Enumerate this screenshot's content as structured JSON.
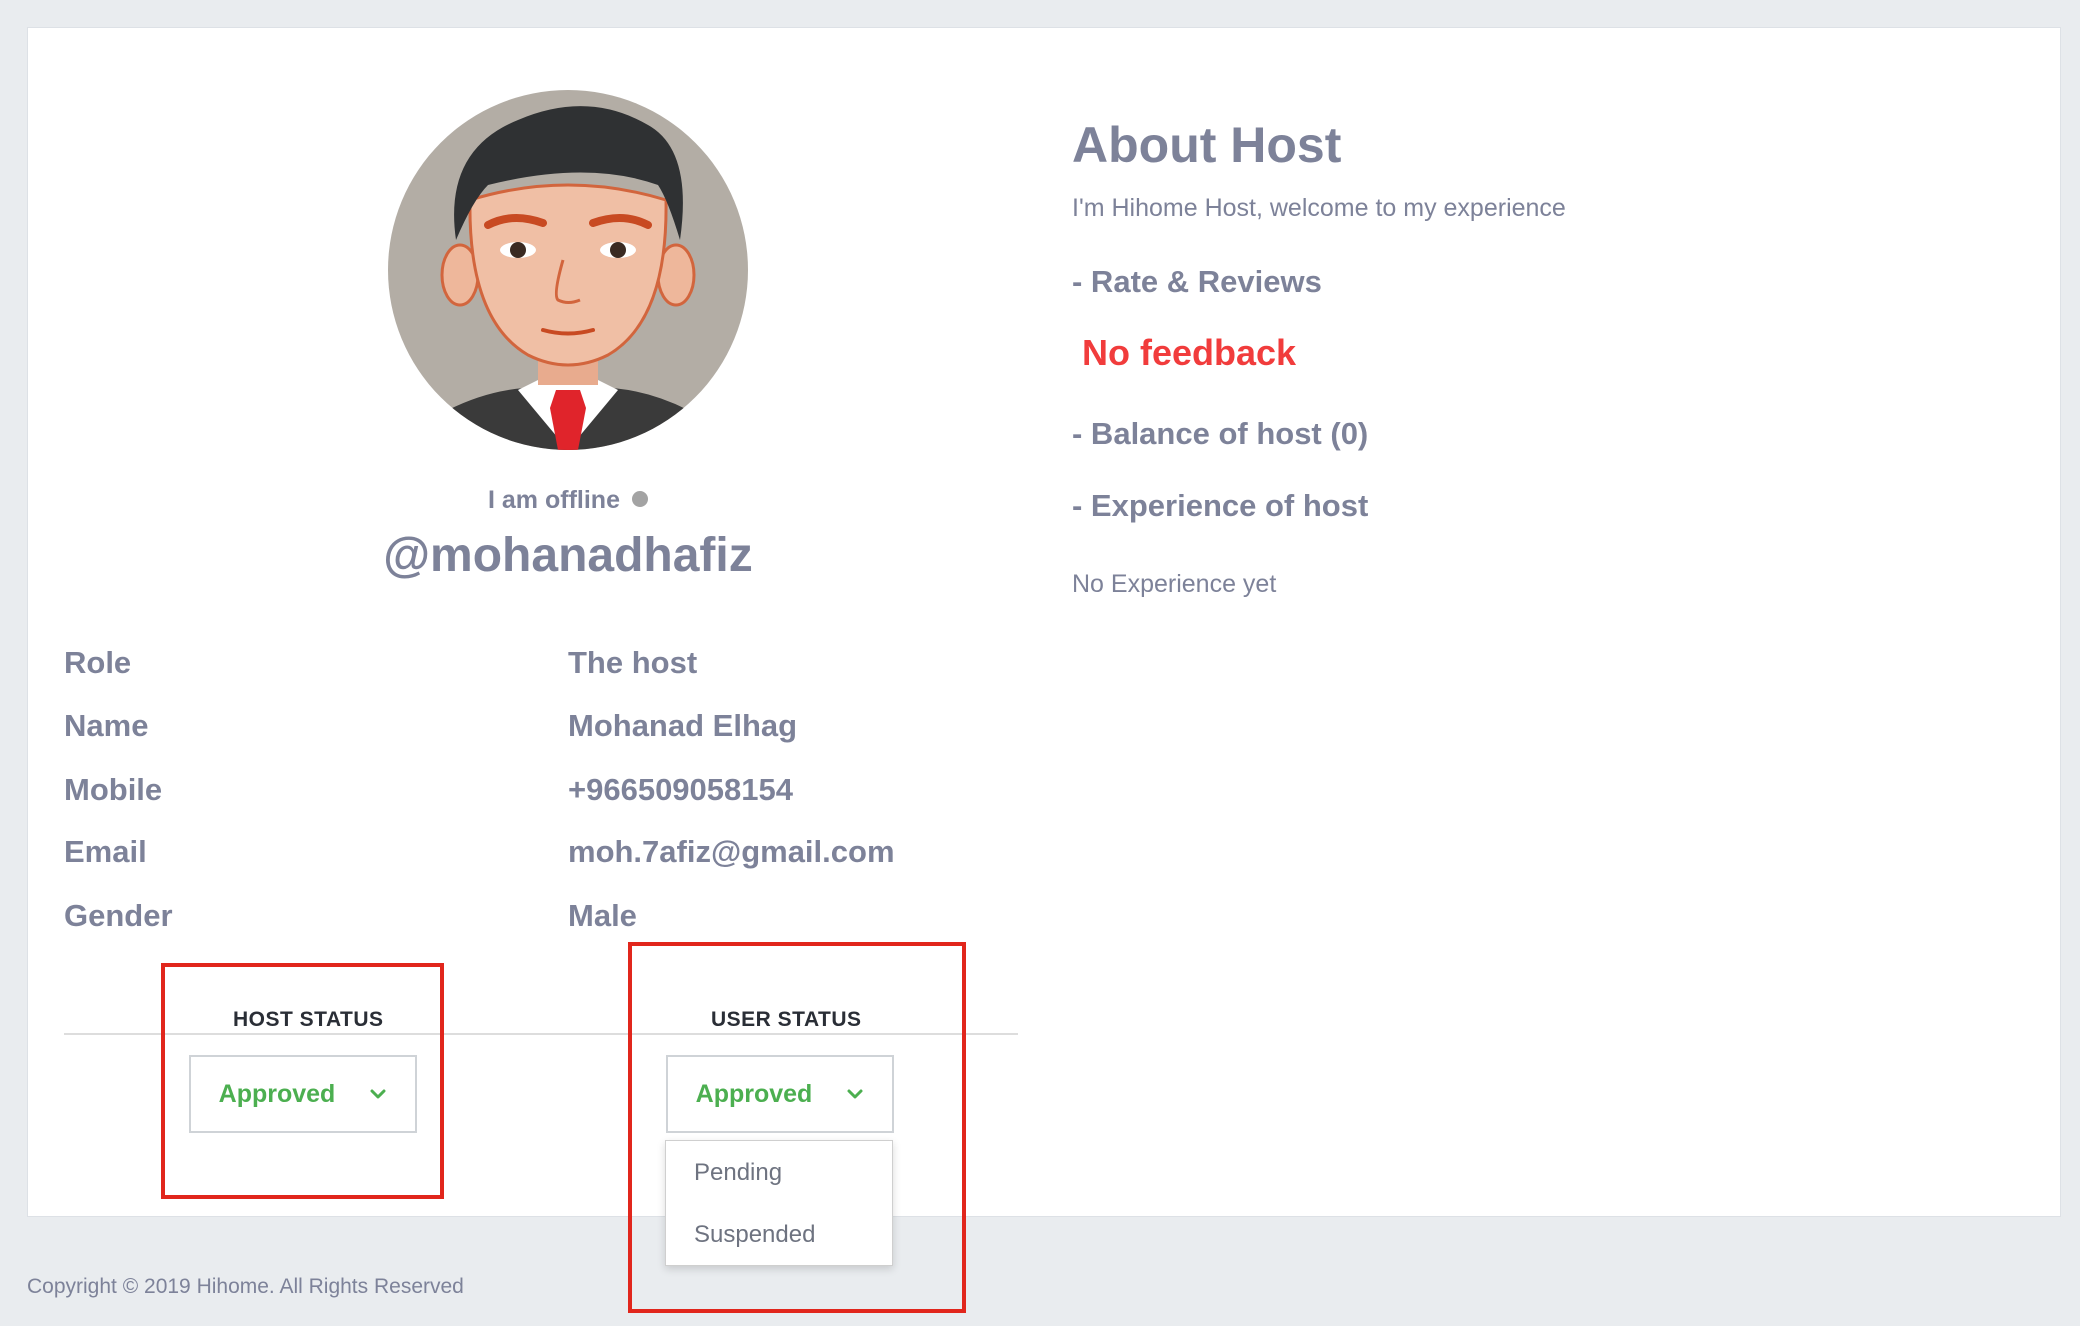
{
  "profile": {
    "presence_text": "I am offline",
    "username": "@mohanadhafiz",
    "avatar_alt": "avatar"
  },
  "info": {
    "rows": [
      {
        "label": "Role",
        "value": "The host"
      },
      {
        "label": "Name",
        "value": "Mohanad Elhag"
      },
      {
        "label": "Mobile",
        "value": "+966509058154"
      },
      {
        "label": "Email",
        "value": "moh.7afiz@gmail.com"
      },
      {
        "label": "Gender",
        "value": "Male"
      }
    ]
  },
  "status": {
    "host_heading": "HOST STATUS",
    "user_heading": "USER STATUS",
    "host_selected": "Approved",
    "user_selected": "Approved",
    "user_options": [
      "Pending",
      "Suspended"
    ]
  },
  "about": {
    "title": "About Host",
    "subtitle": "I'm Hihome Host, welcome to my experience",
    "rate_heading": "- Rate & Reviews",
    "no_feedback": "No feedback",
    "balance_heading": "- Balance of host (0)",
    "experience_heading": "- Experience of host",
    "no_experience": "No Experience yet"
  },
  "footer": {
    "copyright": "Copyright © 2019 Hihome. All Rights Reserved"
  },
  "colors": {
    "background": "#e9ecef",
    "text": "#7d8299",
    "approved": "#4caf50",
    "alert": "#f13c3c",
    "highlight": "#e1261c",
    "offline_dot": "#a3a3a3"
  },
  "icons": {
    "presence": "status-dot-icon",
    "dropdown": "chevron-down-icon"
  }
}
